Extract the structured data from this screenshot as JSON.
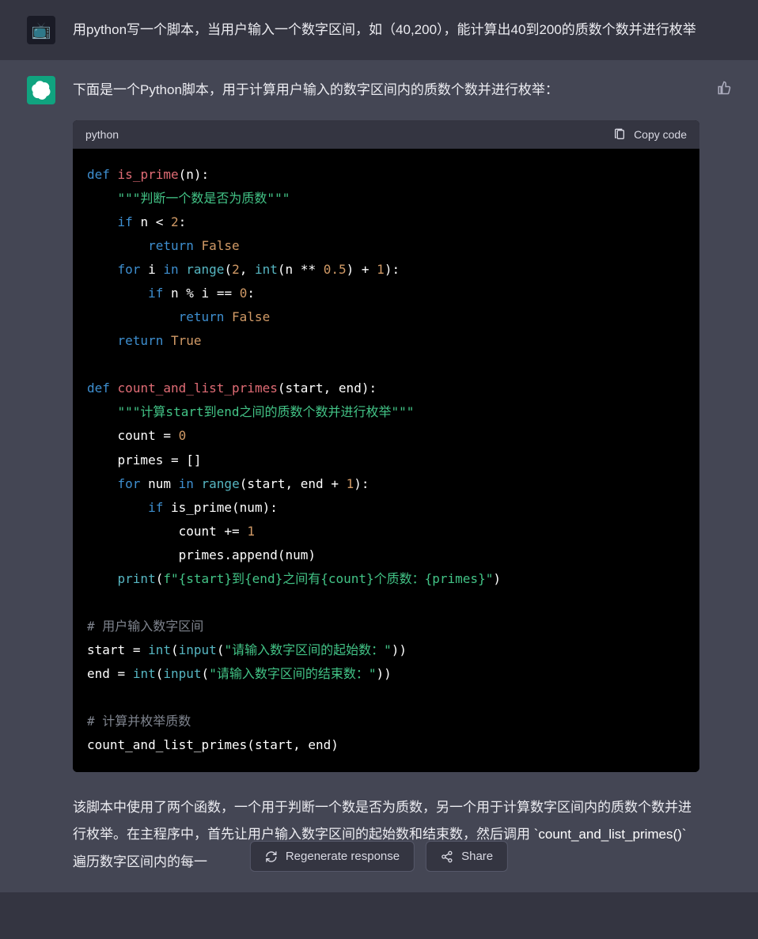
{
  "user_message": "用python写一个脚本，当用户输入一个数字区间，如（40,200），能计算出40到200的质数个数并进行枚举",
  "assistant_intro": "下面是一个Python脚本，用于计算用户输入的数字区间内的质数个数并进行枚举：",
  "code": {
    "language": "python",
    "copy_label": "Copy code"
  },
  "tokens": {
    "def": "def",
    "is_prime": "is_prime",
    "n": "n",
    "doc1": "\"\"\"判断一个数是否为质数\"\"\"",
    "if": "if",
    "lt": "<",
    "two": "2",
    "return": "return",
    "false": "False",
    "for": "for",
    "i": "i",
    "in": "in",
    "range": "range",
    "int": "int",
    "star2": "**",
    "half": "0.5",
    "plus": "+",
    "one": "1",
    "mod": "%",
    "eq": "==",
    "zero": "0",
    "true": "True",
    "count_fn": "count_and_list_primes",
    "start": "start",
    "end": "end",
    "doc2": "\"\"\"计算start到end之间的质数个数并进行枚举\"\"\"",
    "count": "count",
    "assign": "=",
    "primes": "primes",
    "brackets": "[]",
    "num": "num",
    "pluseq": "+=",
    "append": "append",
    "print": "print",
    "fstr": "f\"{start}到{end}之间有{count}个质数：{primes}\"",
    "cmt1": "# 用户输入数字区间",
    "input": "input",
    "prompt1": "\"请输入数字区间的起始数：\"",
    "prompt2": "\"请输入数字区间的结束数：\"",
    "cmt2": "# 计算并枚举质数"
  },
  "explain": {
    "p1a": "该脚本中使用了两个函数，一个用于判断一个数是否为质数，另一个用于计算数字区间内的质数个数并进行枚举。在主程序中，首先让用户输入数字区间的起始数和结束数，然后调用 ",
    "p1code": "`count_and_list_primes()`",
    "p1b": " 遍历数字区间内的每一"
  },
  "buttons": {
    "regenerate": "Regenerate response",
    "share": "Share"
  }
}
